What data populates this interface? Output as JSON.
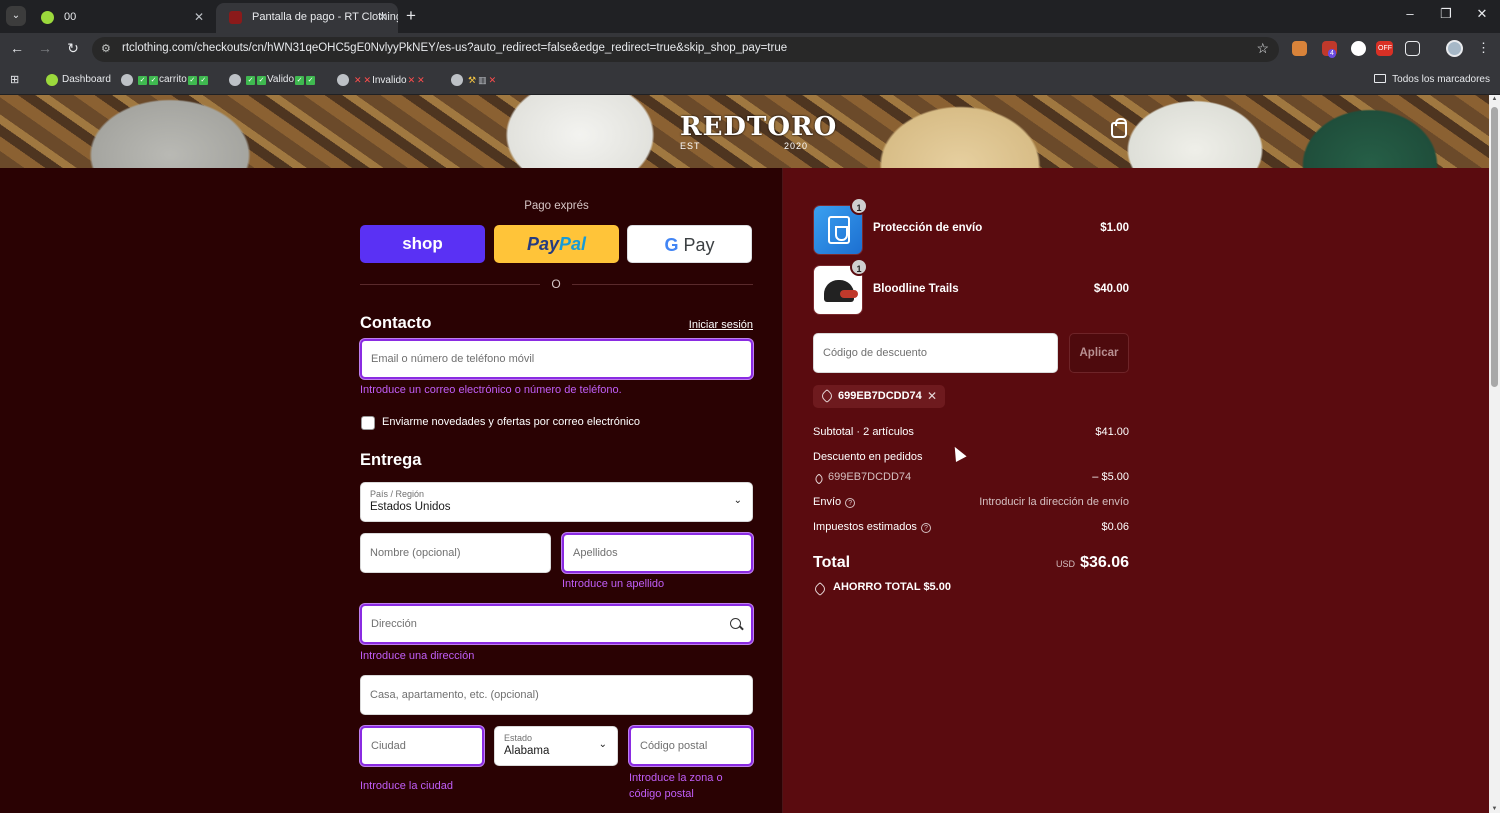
{
  "browser": {
    "tabs": [
      {
        "title": "00"
      },
      {
        "title": "Pantalla de pago - RT Clothing"
      }
    ],
    "url": "rtclothing.com/checkouts/cn/hWN31qeOHC5gE0NvlyyPkNEY/es-us?auto_redirect=false&edge_redirect=true&skip_shop_pay=true",
    "extension_badges": {
      "shield": "4",
      "off": "OFF"
    },
    "bookmarks": {
      "dashboard": "Dashboard",
      "carrito": "carrito",
      "valido": "Valido",
      "invalido": "Invalido",
      "all": "Todos los marcadores"
    }
  },
  "header": {
    "logo": "REDTORO",
    "logo_est": "EST",
    "logo_year": "2020"
  },
  "express": {
    "title": "Pago exprés",
    "shop": "shop",
    "paypal_pay": "Pay",
    "paypal_pal": "Pal",
    "gpay_g": "G",
    "gpay_pay": "Pay",
    "or": "O"
  },
  "contact": {
    "heading": "Contacto",
    "signin": "Iniciar sesión",
    "email_placeholder": "Email o número de teléfono móvil",
    "email_error": "Introduce un correo electrónico o número de teléfono.",
    "newsletter_label": "Enviarme novedades y ofertas por correo electrónico"
  },
  "delivery": {
    "heading": "Entrega",
    "country_label": "País / Región",
    "country_value": "Estados Unidos",
    "first_name_placeholder": "Nombre (opcional)",
    "last_name_placeholder": "Apellidos",
    "last_name_error": "Introduce un apellido",
    "address_placeholder": "Dirección",
    "address_error": "Introduce una dirección",
    "apartment_placeholder": "Casa, apartamento, etc. (opcional)",
    "city_placeholder": "Ciudad",
    "city_error": "Introduce la ciudad",
    "state_label": "Estado",
    "state_value": "Alabama",
    "zip_placeholder": "Código postal",
    "zip_error_1": "Introduce la zona o",
    "zip_error_2": "código postal"
  },
  "summary": {
    "items": [
      {
        "name": "Protección de envío",
        "price": "$1.00",
        "qty": "1"
      },
      {
        "name": "Bloodline Trails",
        "price": "$40.00",
        "qty": "1"
      }
    ],
    "discount_placeholder": "Código de descuento",
    "apply": "Aplicar",
    "code": "699EB7DCDD74",
    "subtotal_label": "Subtotal · 2 artículos",
    "subtotal": "$41.00",
    "order_discount_label": "Descuento en pedidos",
    "order_discount_code": "699EB7DCDD74",
    "order_discount": "– $5.00",
    "shipping_label": "Envío",
    "shipping_value": "Introducir la dirección de envío",
    "taxes_label": "Impuestos estimados",
    "taxes": "$0.06",
    "total_label": "Total",
    "currency": "USD",
    "total": "$36.06",
    "savings": "AHORRO TOTAL  $5.00"
  },
  "colors": {
    "left_bg": "#2a0203",
    "right_bg": "#5a0b0f",
    "error": "#c05ef7",
    "shop": "#5a31f4",
    "paypal": "#ffc439"
  }
}
